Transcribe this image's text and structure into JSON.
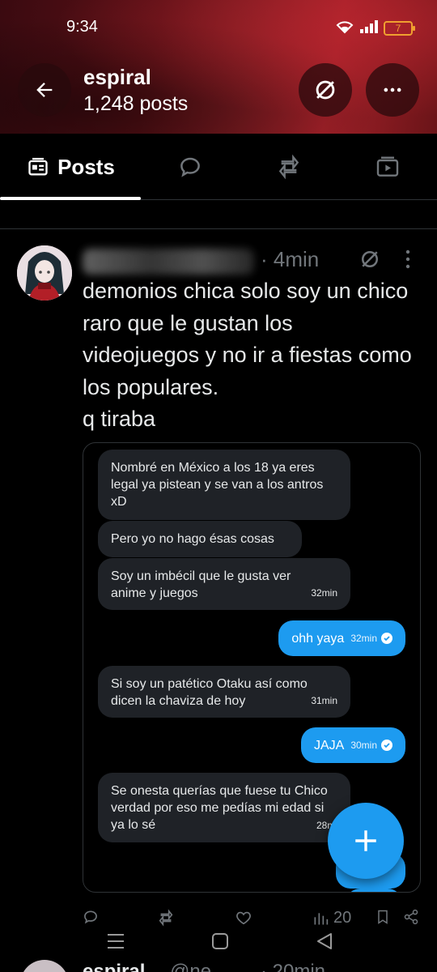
{
  "status_bar": {
    "time": "9:34",
    "battery_level": "7",
    "icons": [
      "wifi-icon",
      "signal-icon",
      "battery-icon"
    ]
  },
  "header": {
    "back_icon": "arrow-left-icon",
    "name": "espiral",
    "post_count": "1,248 posts",
    "grok_icon": "grok-icon",
    "more_icon": "more-horizontal-icon"
  },
  "tabs": [
    {
      "label": "Posts",
      "icon": "posts-icon",
      "active": true
    },
    {
      "label": "",
      "icon": "reply-bubble-icon",
      "active": false
    },
    {
      "label": "",
      "icon": "repost-icon",
      "active": false
    },
    {
      "label": "",
      "icon": "media-play-icon",
      "active": false
    }
  ],
  "post": {
    "time": "· 4min",
    "text": "demonios chica solo soy un chico raro que le gustan los videojuegos y no ir a fiestas como los populares.\nq tiraba",
    "views": "20"
  },
  "chat": [
    {
      "side": "in",
      "text": "Nombré en México a los 18 ya eres legal ya pistean y se van a los antros xD",
      "time": ""
    },
    {
      "side": "in",
      "text": "Pero yo no hago ésas cosas",
      "time": ""
    },
    {
      "side": "in",
      "text": "Soy un imbécil que le gusta ver anime y juegos",
      "time": "32min"
    },
    {
      "side": "out",
      "text": "ohh yaya",
      "time": "32min"
    },
    {
      "side": "in",
      "text": "Si soy un patético Otaku así como dicen la chaviza de hoy",
      "time": "31min"
    },
    {
      "side": "out",
      "text": "JAJA",
      "time": "30min"
    },
    {
      "side": "in",
      "text": "Se onesta querías que fuese tu Chico verdad por eso me pedías mi edad si ya lo sé",
      "time": "28mi"
    }
  ],
  "next_post": {
    "name": "espiral",
    "handle": "@ne",
    "time": "· 20min"
  },
  "colors": {
    "accent": "#1d9bf0",
    "muted": "#71767b",
    "header_red": "#8a1a20"
  }
}
